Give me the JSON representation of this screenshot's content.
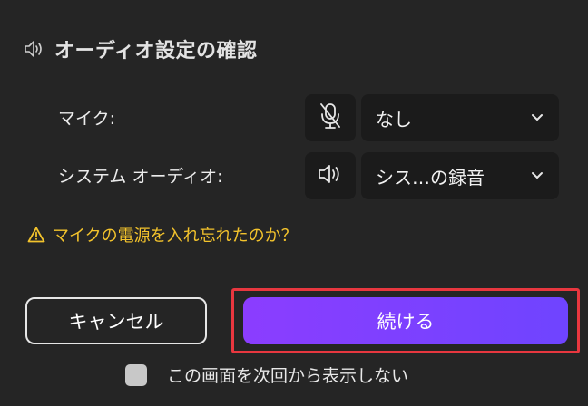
{
  "dialog": {
    "title": "オーディオ設定の確認",
    "title_icon": "speaker-icon"
  },
  "mic": {
    "label": "マイク:",
    "icon": "mic-off-icon",
    "selected": "なし"
  },
  "system_audio": {
    "label": "システム オーディオ:",
    "icon": "speaker-icon",
    "selected": "シス…の録音"
  },
  "warning": {
    "icon": "warning-triangle-icon",
    "text": "マイクの電源を入れ忘れたのか？",
    "color": "#f3c32c"
  },
  "buttons": {
    "cancel": "キャンセル",
    "continue": "続ける"
  },
  "dont_show_again": {
    "label": "この画面を次回から表示しない",
    "checked": false
  },
  "colors": {
    "background": "#252525",
    "control_bg": "#1b1b1b",
    "accent_gradient_start": "#8b3dff",
    "accent_gradient_end": "#6f44ff",
    "highlight": "#e8373f"
  }
}
